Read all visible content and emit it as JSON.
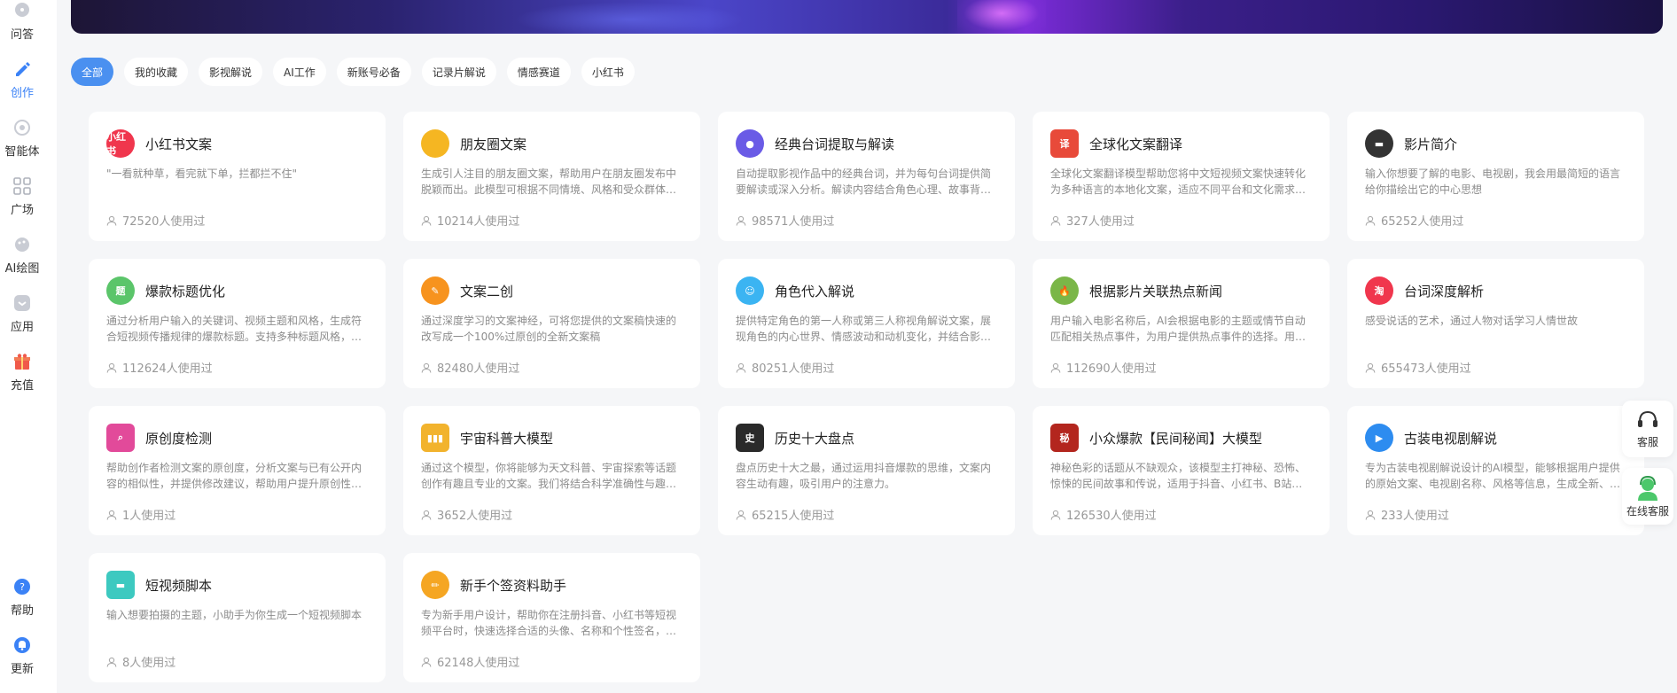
{
  "sidebar": {
    "items": [
      {
        "label": "问答",
        "icon": "chat-icon",
        "active": false
      },
      {
        "label": "创作",
        "icon": "pencil-icon",
        "active": true
      },
      {
        "label": "智能体",
        "icon": "agent-icon",
        "active": false
      },
      {
        "label": "广场",
        "icon": "grid-icon",
        "active": false
      },
      {
        "label": "AI绘图",
        "icon": "palette-icon",
        "active": false
      },
      {
        "label": "应用",
        "icon": "app-icon",
        "active": false
      },
      {
        "label": "充值",
        "icon": "gift-icon",
        "active": false
      }
    ],
    "bottom": [
      {
        "label": "帮助",
        "icon": "help-icon"
      },
      {
        "label": "更新",
        "icon": "bell-icon"
      }
    ]
  },
  "tabs": [
    "全部",
    "我的收藏",
    "影视解说",
    "AI工作",
    "新账号必备",
    "记录片解说",
    "情感赛道",
    "小红书"
  ],
  "active_tab": "全部",
  "cards": [
    {
      "title": "小红书文案",
      "desc": "\"一看就种草，看完就下单，拦都拦不住\"",
      "usage": "72520人使用过",
      "icon": "xiaohongshu-icon",
      "icon_text": "小红书",
      "color": "#f0364d"
    },
    {
      "title": "朋友圈文案",
      "desc": "生成引人注目的朋友圈文案，帮助用户在朋友圈发布中脱颖而出。此模型可根据不同情境、风格和受众群体…",
      "usage": "10214人使用过",
      "icon": "pinwheel-icon",
      "icon_text": "",
      "color": "#f5b622"
    },
    {
      "title": "经典台词提取与解读",
      "desc": "自动提取影视作品中的经典台词，并为每句台词提供简要解读或深入分析。解读内容结合角色心理、故事背…",
      "usage": "98571人使用过",
      "icon": "film-reel-icon",
      "icon_text": "●",
      "color": "#6a5be6"
    },
    {
      "title": "全球化文案翻译",
      "desc": "全球化文案翻译模型帮助您将中文短视频文案快速转化为多种语言的本地化文案，适应不同平台和文化需求…",
      "usage": "327人使用过",
      "icon": "translate-icon",
      "icon_text": "译",
      "color": "#e84a3a"
    },
    {
      "title": "影片简介",
      "desc": "输入你想要了解的电影、电视剧，我会用最简短的语言给你描绘出它的中心思想",
      "usage": "65252人使用过",
      "icon": "clapperboard-icon",
      "icon_text": "▬",
      "color": "#333333"
    },
    {
      "title": "爆款标题优化",
      "desc": "通过分析用户输入的关键词、视频主题和风格，生成符合短视频传播规律的爆款标题。支持多种标题风格，…",
      "usage": "112624人使用过",
      "icon": "title-icon",
      "icon_text": "题",
      "color": "#5bc56a"
    },
    {
      "title": "文案二创",
      "desc": "通过深度学习的文案神经，可将您提供的文案稿快速的改写成一个100%过原创的全新文案稿",
      "usage": "82480人使用过",
      "icon": "edit-icon",
      "icon_text": "✎",
      "color": "#f7931e"
    },
    {
      "title": "角色代入解说",
      "desc": "提供特定角色的第一人称或第三人称视角解说文案，展现角色的内心世界、情感波动和动机变化，并结合影…",
      "usage": "80251人使用过",
      "icon": "person-icon",
      "icon_text": "☺",
      "color": "#3bb4f2"
    },
    {
      "title": "根据影片关联热点新闻",
      "desc": "用户输入电影名称后，AI会根据电影的主题或情节自动匹配相关热点事件，为用户提供热点事件的选择。用…",
      "usage": "112690人使用过",
      "icon": "fire-icon",
      "icon_text": "🔥",
      "color": "#7ab648"
    },
    {
      "title": "台词深度解析",
      "desc": "感受说话的艺术，通过人物对话学习人情世故",
      "usage": "655473人使用过",
      "icon": "taobao-icon",
      "icon_text": "淘",
      "color": "#f0364d"
    },
    {
      "title": "原创度检测",
      "desc": "帮助创作者检测文案的原创度，分析文案与已有公开内容的相似性，并提供修改建议，帮助用户提升原创性…",
      "usage": "1人使用过",
      "icon": "magnifier-icon",
      "icon_text": "⌕",
      "color": "#e24a9a"
    },
    {
      "title": "宇宙科普大模型",
      "desc": "通过这个模型，你将能够为天文科普、宇宙探索等话题创作有趣且专业的文案。我们将结合科学准确性与趣…",
      "usage": "3652人使用过",
      "icon": "books-icon",
      "icon_text": "▮▮▮",
      "color": "#f2b32d"
    },
    {
      "title": "历史十大盘点",
      "desc": "盘点历史十大之最，通过运用抖音爆款的思维，文案内容生动有趣，吸引用户的注意力。",
      "usage": "65215人使用过",
      "icon": "history-icon",
      "icon_text": "史",
      "color": "#2a2a2a"
    },
    {
      "title": "小众爆款【民间秘闻】大模型",
      "desc": "神秘色彩的话题从不缺观众，该模型主打神秘、恐怖、惊悚的民间故事和传说，适用于抖音、小红书、B站…",
      "usage": "126530人使用过",
      "icon": "mystery-icon",
      "icon_text": "秘",
      "color": "#b3261e"
    },
    {
      "title": "古装电视剧解说",
      "desc": "专为古装电视剧解说设计的AI模型，能够根据用户提供的原始文案、电视剧名称、风格等信息，生成全新、…",
      "usage": "233人使用过",
      "icon": "play-icon",
      "icon_text": "▶",
      "color": "#2d8cf0"
    },
    {
      "title": "短视频脚本",
      "desc": "输入想要拍摄的主题，小助手为你生成一个短视频脚本",
      "usage": "8人使用过",
      "icon": "clapper-icon",
      "icon_text": "▬",
      "color": "#3dc9c0"
    },
    {
      "title": "新手个签资料助手",
      "desc": "专为新手用户设计，帮助你在注册抖音、小红书等短视频平台时，快速选择合适的头像、名称和个性签名，…",
      "usage": "62148人使用过",
      "icon": "pencil-icon",
      "icon_text": "✏",
      "color": "#f5a623"
    }
  ],
  "float_buttons": [
    {
      "label": "客服",
      "icon": "headset-icon"
    },
    {
      "label": "在线客服",
      "icon": "support-agent-icon"
    }
  ]
}
